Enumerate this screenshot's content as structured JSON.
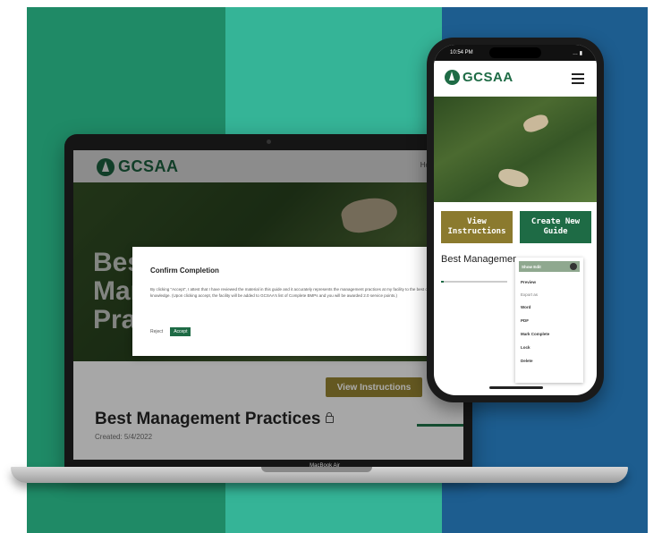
{
  "colors": {
    "brand_green": "#1e6b45",
    "gold": "#8b7a2e",
    "stripe_left": "#1f8a66",
    "stripe_mid": "#35b497",
    "stripe_right": "#1d5d8f"
  },
  "laptop": {
    "logo_text": "GCSAA",
    "nav": [
      "Home",
      "Lo"
    ],
    "hero_title": "Best Management Practices",
    "modal": {
      "title": "Confirm Completion",
      "body": "By clicking \"Accept\", I attest that I have reviewed the material in this guide and it accurately represents the management practices at my facility to the best of my knowledge. (Upon clicking accept, the facility will be added to GCSAA's list of Complete BMPs and you will be awarded 2.0 service points.)",
      "reject": "Reject",
      "accept": "Accept"
    },
    "view_instructions": "View Instructions",
    "guide_title": "Best Management Practices",
    "created": "Created: 5/4/2022",
    "progress": 0.85,
    "model_label": "MacBook Air"
  },
  "phone": {
    "time": "10:54 PM",
    "status_right": "… ▮",
    "logo_text": "GCSAA",
    "btn_view": "View Instructions",
    "btn_create": "Create New Guide",
    "guide_title": "Best Management Practices",
    "progress": 0.04,
    "dropdown": {
      "toggle_label": "Show Edit",
      "items": [
        "Preview"
      ],
      "export_label": "Export as",
      "export_items": [
        "Word",
        "PDF"
      ],
      "more_items": [
        "Mark Complete",
        "Lock",
        "Delete"
      ]
    }
  }
}
